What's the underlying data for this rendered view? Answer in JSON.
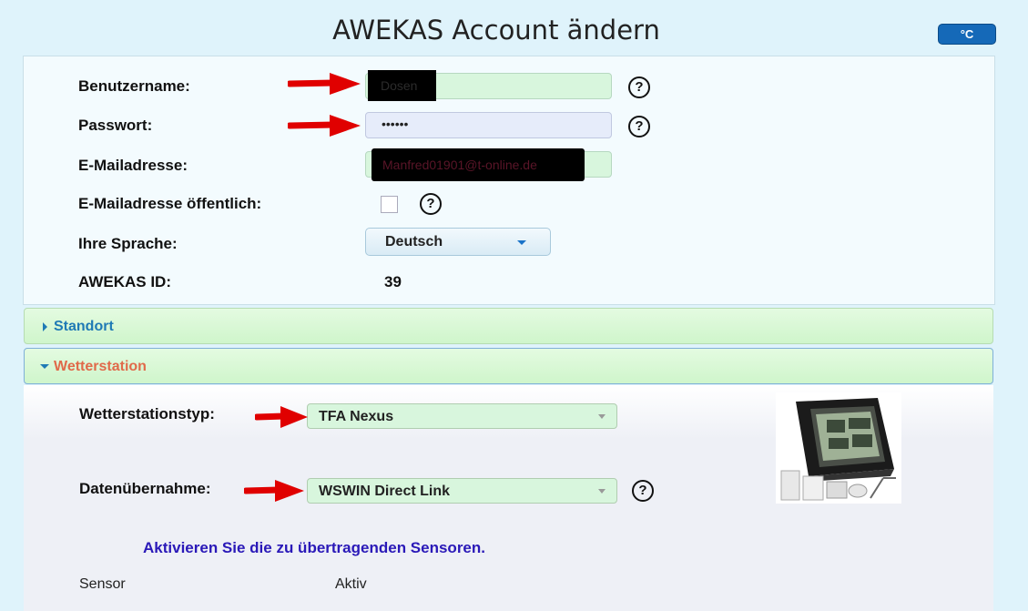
{
  "page": {
    "title": "AWEKAS Account ändern",
    "unit_button": "°C"
  },
  "account": {
    "username_label": "Benutzername:",
    "username_value": "Dosen",
    "password_label": "Passwort:",
    "password_value": "••••••",
    "email_label": "E-Mailadresse:",
    "email_value": "Manfred01901@t-online.de",
    "email_public_label": "E-Mailadresse öffentlich:",
    "help_glyph": "?",
    "language_label": "Ihre Sprache:",
    "language_value": "Deutsch",
    "id_label": "AWEKAS ID:",
    "id_value": "39"
  },
  "sections": {
    "standort_label": "Standort",
    "wetterstation_label": "Wetterstation"
  },
  "station": {
    "type_label": "Wetterstationstyp:",
    "type_value": "TFA Nexus",
    "data_label": "Datenübernahme:",
    "data_value": "WSWIN Direct Link",
    "activate_note": "Aktivieren Sie die zu übertragenden Sensoren.",
    "col_sensor": "Sensor",
    "col_aktiv": "Aktiv"
  },
  "colors": {
    "accent_blue": "#1569b8",
    "field_green": "#d8f6dd",
    "header_green": "#cff5cb",
    "active_section_text": "#e06a4a",
    "link_text": "#1f7ab5",
    "note_text": "#2a19b8",
    "arrow_red": "#e00000"
  },
  "icons": {
    "help": "help-circle-icon",
    "arrow": "red-arrow-annotation",
    "collapse": "triangle-right-icon",
    "expand": "triangle-down-icon",
    "dropdown": "caret-down-icon"
  }
}
